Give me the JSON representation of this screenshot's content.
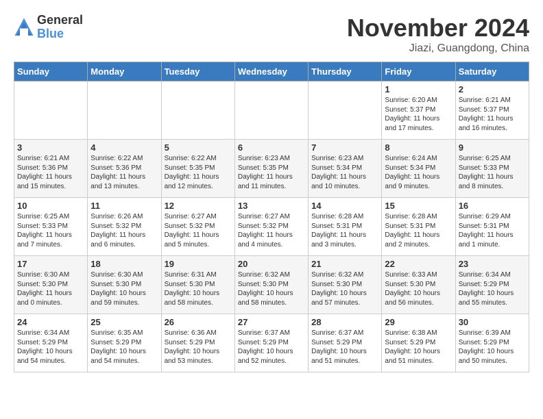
{
  "logo": {
    "general": "General",
    "blue": "Blue"
  },
  "title": "November 2024",
  "location": "Jiazi, Guangdong, China",
  "days_of_week": [
    "Sunday",
    "Monday",
    "Tuesday",
    "Wednesday",
    "Thursday",
    "Friday",
    "Saturday"
  ],
  "weeks": [
    [
      {
        "day": "",
        "text": ""
      },
      {
        "day": "",
        "text": ""
      },
      {
        "day": "",
        "text": ""
      },
      {
        "day": "",
        "text": ""
      },
      {
        "day": "",
        "text": ""
      },
      {
        "day": "1",
        "text": "Sunrise: 6:20 AM\nSunset: 5:37 PM\nDaylight: 11 hours and 17 minutes."
      },
      {
        "day": "2",
        "text": "Sunrise: 6:21 AM\nSunset: 5:37 PM\nDaylight: 11 hours and 16 minutes."
      }
    ],
    [
      {
        "day": "3",
        "text": "Sunrise: 6:21 AM\nSunset: 5:36 PM\nDaylight: 11 hours and 15 minutes."
      },
      {
        "day": "4",
        "text": "Sunrise: 6:22 AM\nSunset: 5:36 PM\nDaylight: 11 hours and 13 minutes."
      },
      {
        "day": "5",
        "text": "Sunrise: 6:22 AM\nSunset: 5:35 PM\nDaylight: 11 hours and 12 minutes."
      },
      {
        "day": "6",
        "text": "Sunrise: 6:23 AM\nSunset: 5:35 PM\nDaylight: 11 hours and 11 minutes."
      },
      {
        "day": "7",
        "text": "Sunrise: 6:23 AM\nSunset: 5:34 PM\nDaylight: 11 hours and 10 minutes."
      },
      {
        "day": "8",
        "text": "Sunrise: 6:24 AM\nSunset: 5:34 PM\nDaylight: 11 hours and 9 minutes."
      },
      {
        "day": "9",
        "text": "Sunrise: 6:25 AM\nSunset: 5:33 PM\nDaylight: 11 hours and 8 minutes."
      }
    ],
    [
      {
        "day": "10",
        "text": "Sunrise: 6:25 AM\nSunset: 5:33 PM\nDaylight: 11 hours and 7 minutes."
      },
      {
        "day": "11",
        "text": "Sunrise: 6:26 AM\nSunset: 5:32 PM\nDaylight: 11 hours and 6 minutes."
      },
      {
        "day": "12",
        "text": "Sunrise: 6:27 AM\nSunset: 5:32 PM\nDaylight: 11 hours and 5 minutes."
      },
      {
        "day": "13",
        "text": "Sunrise: 6:27 AM\nSunset: 5:32 PM\nDaylight: 11 hours and 4 minutes."
      },
      {
        "day": "14",
        "text": "Sunrise: 6:28 AM\nSunset: 5:31 PM\nDaylight: 11 hours and 3 minutes."
      },
      {
        "day": "15",
        "text": "Sunrise: 6:28 AM\nSunset: 5:31 PM\nDaylight: 11 hours and 2 minutes."
      },
      {
        "day": "16",
        "text": "Sunrise: 6:29 AM\nSunset: 5:31 PM\nDaylight: 11 hours and 1 minute."
      }
    ],
    [
      {
        "day": "17",
        "text": "Sunrise: 6:30 AM\nSunset: 5:30 PM\nDaylight: 11 hours and 0 minutes."
      },
      {
        "day": "18",
        "text": "Sunrise: 6:30 AM\nSunset: 5:30 PM\nDaylight: 10 hours and 59 minutes."
      },
      {
        "day": "19",
        "text": "Sunrise: 6:31 AM\nSunset: 5:30 PM\nDaylight: 10 hours and 58 minutes."
      },
      {
        "day": "20",
        "text": "Sunrise: 6:32 AM\nSunset: 5:30 PM\nDaylight: 10 hours and 58 minutes."
      },
      {
        "day": "21",
        "text": "Sunrise: 6:32 AM\nSunset: 5:30 PM\nDaylight: 10 hours and 57 minutes."
      },
      {
        "day": "22",
        "text": "Sunrise: 6:33 AM\nSunset: 5:30 PM\nDaylight: 10 hours and 56 minutes."
      },
      {
        "day": "23",
        "text": "Sunrise: 6:34 AM\nSunset: 5:29 PM\nDaylight: 10 hours and 55 minutes."
      }
    ],
    [
      {
        "day": "24",
        "text": "Sunrise: 6:34 AM\nSunset: 5:29 PM\nDaylight: 10 hours and 54 minutes."
      },
      {
        "day": "25",
        "text": "Sunrise: 6:35 AM\nSunset: 5:29 PM\nDaylight: 10 hours and 54 minutes."
      },
      {
        "day": "26",
        "text": "Sunrise: 6:36 AM\nSunset: 5:29 PM\nDaylight: 10 hours and 53 minutes."
      },
      {
        "day": "27",
        "text": "Sunrise: 6:37 AM\nSunset: 5:29 PM\nDaylight: 10 hours and 52 minutes."
      },
      {
        "day": "28",
        "text": "Sunrise: 6:37 AM\nSunset: 5:29 PM\nDaylight: 10 hours and 51 minutes."
      },
      {
        "day": "29",
        "text": "Sunrise: 6:38 AM\nSunset: 5:29 PM\nDaylight: 10 hours and 51 minutes."
      },
      {
        "day": "30",
        "text": "Sunrise: 6:39 AM\nSunset: 5:29 PM\nDaylight: 10 hours and 50 minutes."
      }
    ]
  ]
}
